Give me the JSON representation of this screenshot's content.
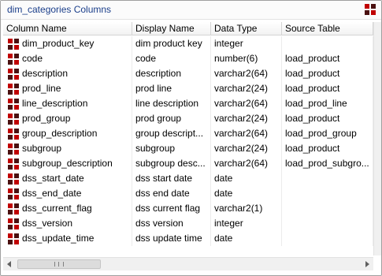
{
  "window": {
    "title": "dim_categories Columns"
  },
  "columns": [
    "Column Name",
    "Display Name",
    "Data Type",
    "Source Table"
  ],
  "rows": [
    {
      "name": "dim_product_key",
      "display": "dim product key",
      "type": "integer",
      "source": ""
    },
    {
      "name": "code",
      "display": "code",
      "type": "number(6)",
      "source": "load_product"
    },
    {
      "name": "description",
      "display": "description",
      "type": "varchar2(64)",
      "source": "load_product"
    },
    {
      "name": "prod_line",
      "display": "prod line",
      "type": "varchar2(24)",
      "source": "load_product"
    },
    {
      "name": "line_description",
      "display": "line description",
      "type": "varchar2(64)",
      "source": "load_prod_line"
    },
    {
      "name": "prod_group",
      "display": "prod group",
      "type": "varchar2(24)",
      "source": "load_product"
    },
    {
      "name": "group_description",
      "display": "group descript...",
      "type": "varchar2(64)",
      "source": "load_prod_group"
    },
    {
      "name": "subgroup",
      "display": "subgroup",
      "type": "varchar2(24)",
      "source": "load_product"
    },
    {
      "name": "subgroup_description",
      "display": "subgroup desc...",
      "type": "varchar2(64)",
      "source": "load_prod_subgro..."
    },
    {
      "name": "dss_start_date",
      "display": "dss start date",
      "type": "date",
      "source": ""
    },
    {
      "name": "dss_end_date",
      "display": "dss end date",
      "type": "date",
      "source": ""
    },
    {
      "name": "dss_current_flag",
      "display": "dss current flag",
      "type": "varchar2(1)",
      "source": ""
    },
    {
      "name": "dss_version",
      "display": "dss version",
      "type": "integer",
      "source": ""
    },
    {
      "name": "dss_update_time",
      "display": "dss update time",
      "type": "date",
      "source": ""
    }
  ],
  "scrollbar": {
    "thumb_label": "III"
  },
  "colors": {
    "title": "#1a3e8a",
    "icon": "#c00000"
  }
}
